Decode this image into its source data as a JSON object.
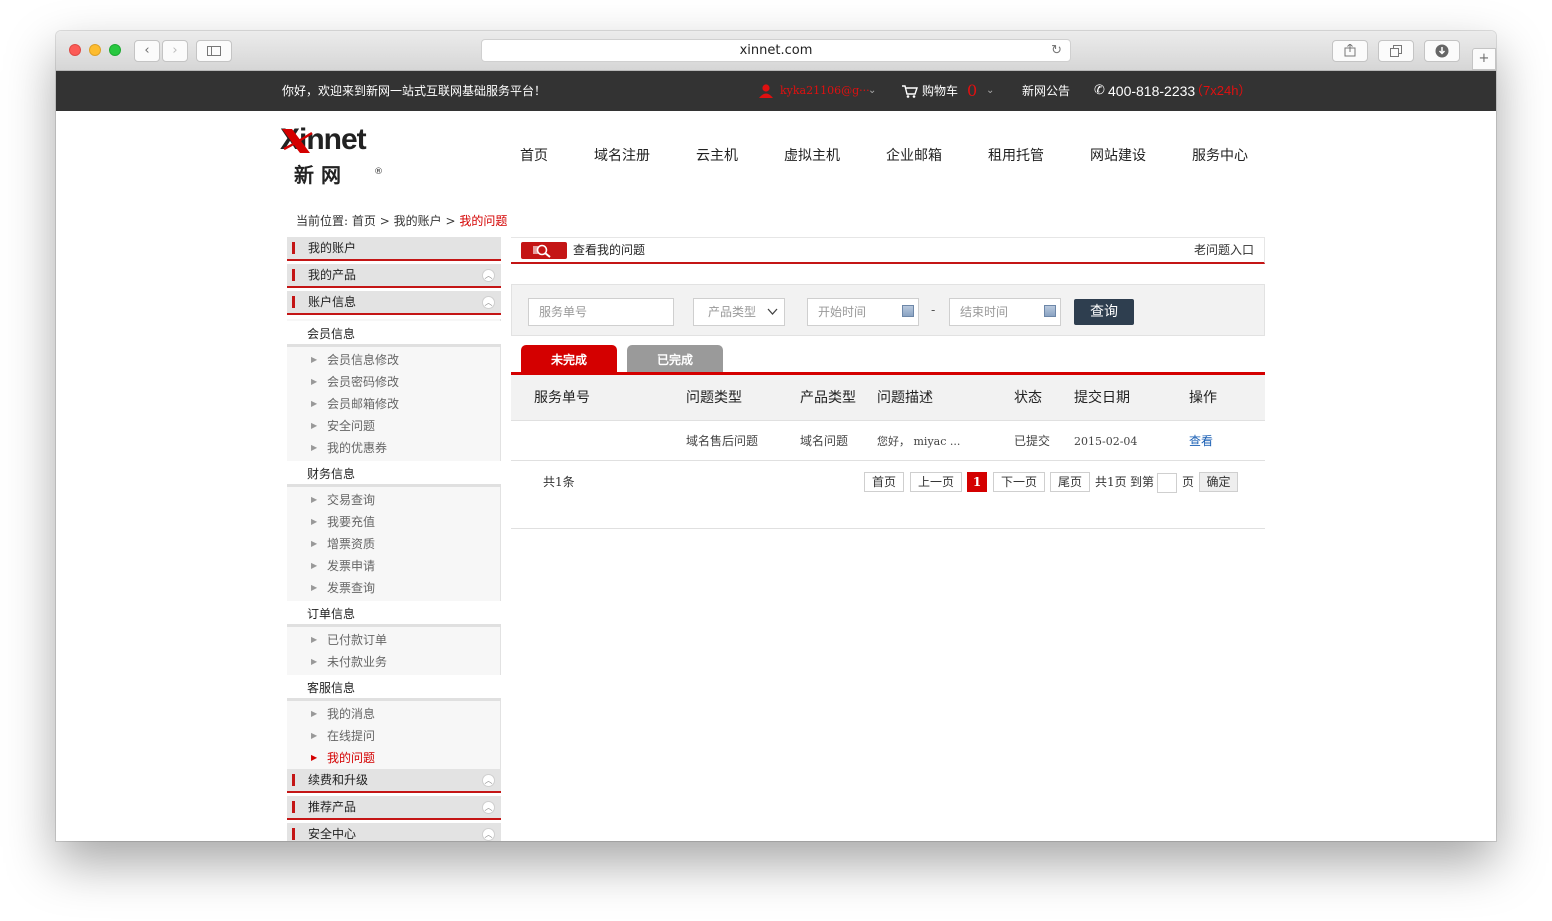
{
  "browser": {
    "url": "xinnet.com"
  },
  "topbar": {
    "welcome": "你好，欢迎来到新网一站式互联网基础服务平台！",
    "user": "kyka21106@g···",
    "cart_label": "购物车",
    "cart_count": "0",
    "notice": "新网公告",
    "phone": "400-818-2233",
    "phone_hours": "（7x24h）"
  },
  "logo": {
    "wordmark": "Xinnet",
    "chinese": "新 网"
  },
  "nav": [
    "首页",
    "域名注册",
    "云主机",
    "虚拟主机",
    "企业邮箱",
    "租用托管",
    "网站建设",
    "服务中心"
  ],
  "breadcrumb": {
    "prefix": "当前位置:",
    "home": "首页",
    "account": "我的账户",
    "current": "我的问题",
    "sep": ">"
  },
  "sidebar": {
    "my_account": "我的账户",
    "my_products": "我的产品",
    "account_info": "账户信息",
    "groups": [
      {
        "title": "会员信息",
        "items": [
          "会员信息修改",
          "会员密码修改",
          "会员邮箱修改",
          "安全问题",
          "我的优惠券"
        ]
      },
      {
        "title": "财务信息",
        "items": [
          "交易查询",
          "我要充值",
          "增票资质",
          "发票申请",
          "发票查询"
        ]
      },
      {
        "title": "订单信息",
        "items": [
          "已付款订单",
          "未付款业务"
        ]
      },
      {
        "title": "客服信息",
        "items": [
          "我的消息",
          "在线提问",
          "我的问题"
        ]
      }
    ],
    "renew": "续费和升级",
    "recommend": "推荐产品",
    "security": "安全中心"
  },
  "panel": {
    "title": "查看我的问题",
    "old_entry": "老问题入口"
  },
  "filter": {
    "service_no_placeholder": "服务单号",
    "product_type": "产品类型",
    "start_placeholder": "开始时间",
    "dash": "-",
    "end_placeholder": "结束时间",
    "query_button": "查询"
  },
  "tabs": {
    "pending": "未完成",
    "done": "已完成"
  },
  "table": {
    "headers": [
      "服务单号",
      "问题类型",
      "产品类型",
      "问题描述",
      "状态",
      "提交日期",
      "操作"
    ],
    "rows": [
      {
        "service_no": "",
        "problem_type": "域名售后问题",
        "product_type": "域名问题",
        "description": "您好，  miyac ...",
        "status": "已提交",
        "date": "2015-02-04",
        "action": "查看"
      }
    ]
  },
  "pagination": {
    "total": "共1条",
    "first": "首页",
    "prev": "上一页",
    "current": "1",
    "next": "下一页",
    "last": "尾页",
    "pages": "共1页",
    "goto": "到第",
    "page_unit": "页",
    "confirm": "确定"
  },
  "colors": {
    "brand_red": "#c41515",
    "topbar_bg": "#333333",
    "query_btn": "#2e3e4f",
    "tab_active": "#d40000",
    "tab_inactive": "#9a9a9a",
    "link_blue": "#1a5fb4"
  }
}
